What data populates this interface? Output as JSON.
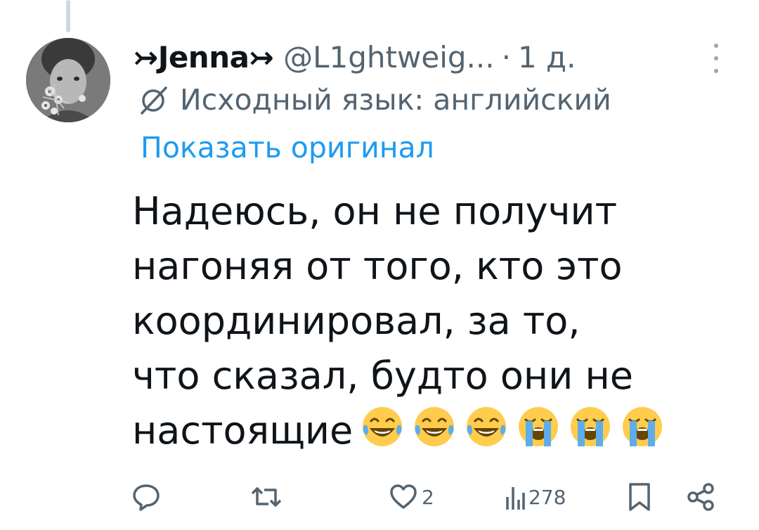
{
  "tweet": {
    "author": {
      "display_name": "↣Jenna↣",
      "handle": "@L1ghtweig...",
      "separator": "·",
      "time": "1 д."
    },
    "translation": {
      "source_language_label": "Исходный язык: английский",
      "show_original_label": "Показать оригинал"
    },
    "text_lines": [
      "Надеюсь, он не получит",
      "нагоняя от того, кто это",
      "координировал, за то,",
      "что сказал, будто они не",
      "настоящие"
    ],
    "emojis": [
      "face-with-tears-of-joy",
      "face-with-tears-of-joy",
      "face-with-tears-of-joy",
      "loudly-crying-face",
      "loudly-crying-face",
      "loudly-crying-face"
    ],
    "actions": {
      "reply_count": "",
      "repost_count": "",
      "like_count": "2",
      "views_count": "278"
    },
    "colors": {
      "accent": "#1d9bf0",
      "secondary_text": "#536471",
      "primary_text": "#0f1419"
    }
  }
}
